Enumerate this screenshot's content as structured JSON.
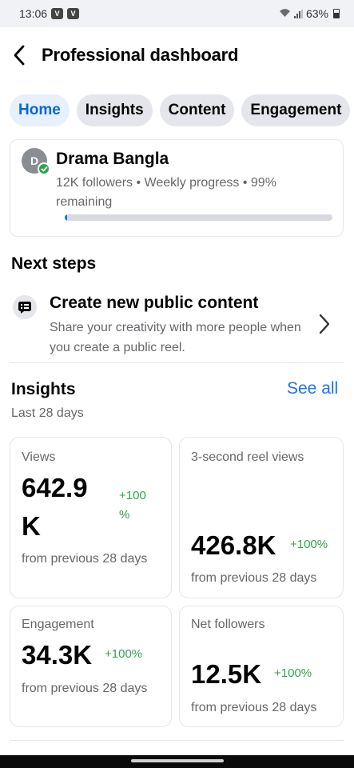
{
  "status_bar": {
    "time": "13:06",
    "notification_glyph": "V",
    "battery": "63%"
  },
  "header": {
    "title": "Professional dashboard",
    "back_icon": "back-arrow-icon"
  },
  "tabs": [
    {
      "label": "Home",
      "active": true
    },
    {
      "label": "Insights",
      "active": false
    },
    {
      "label": "Content",
      "active": false
    },
    {
      "label": "Engagement",
      "active": false
    }
  ],
  "profile": {
    "avatar_letter": "D",
    "name": "Drama Bangla",
    "stats": "12K followers • Weekly progress • 99% remaining",
    "weekly_progress_fraction": 0.01
  },
  "next_steps": {
    "heading": "Next steps",
    "item": {
      "title": "Create new public content",
      "description": "Share your creativity with more people when you create a public reel.",
      "icon": "content-card-icon"
    }
  },
  "insights": {
    "heading": "Insights",
    "see_all": "See all",
    "period": "Last 28 days",
    "metrics": [
      {
        "label": "Views",
        "value_line1": "642.9",
        "value_line2": "K",
        "change_line1": "+100",
        "change_line2": "%",
        "footer": "from previous 28 days"
      },
      {
        "label": "3-second reel views",
        "value": "426.8K",
        "change": "+100%",
        "footer": "from previous 28 days"
      },
      {
        "label": "Engagement",
        "value": "34.3K",
        "change": "+100%",
        "footer": "from previous 28 days"
      },
      {
        "label": "Net followers",
        "value": "12.5K",
        "change": "+100%",
        "footer": "from previous 28 days"
      }
    ]
  },
  "colors": {
    "accent": "#1b74e4",
    "active_tab_bg": "#e7f0fd",
    "positive": "#31a24c",
    "secondary_text": "#65676b"
  }
}
